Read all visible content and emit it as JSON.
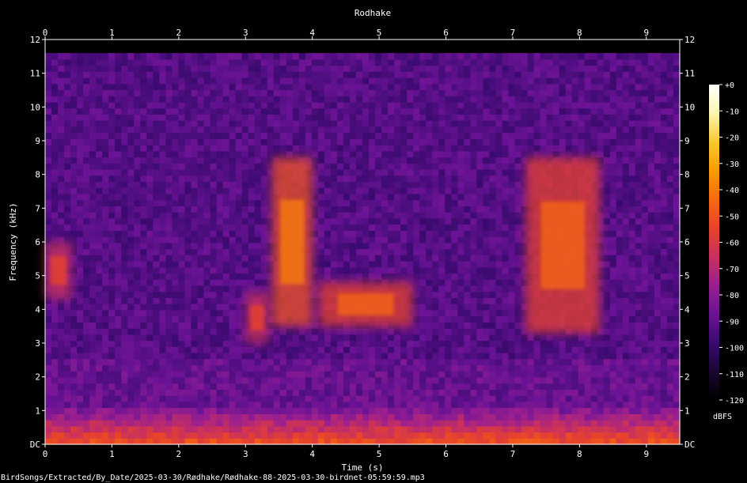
{
  "chart_data": {
    "type": "heatmap",
    "title": "Rodhake",
    "xlabel": "Time (s)",
    "ylabel": "Frequency (kHz)",
    "xlim": [
      0,
      9.5
    ],
    "ylim": [
      0,
      12
    ],
    "x_ticks": [
      "0",
      "1",
      "2",
      "3",
      "4",
      "5",
      "6",
      "7",
      "8",
      "9"
    ],
    "y_ticks": [
      "DC",
      "1",
      "2",
      "3",
      "4",
      "5",
      "6",
      "7",
      "8",
      "9",
      "10",
      "11",
      "12"
    ],
    "colorbar": {
      "label": "dBFS",
      "ticks": [
        "+0",
        "-10",
        "-20",
        "-30",
        "-40",
        "-50",
        "-60",
        "-70",
        "-80",
        "-90",
        "-100",
        "-110",
        "-120"
      ],
      "range": [
        -120,
        0
      ],
      "colors": [
        "#000000",
        "#1a0733",
        "#3a0a6e",
        "#6a1395",
        "#9a1f8f",
        "#c8305e",
        "#e8432b",
        "#f76a10",
        "#fb9b06",
        "#f8c82e",
        "#fcf6b0",
        "#ffffff"
      ]
    },
    "vocal_events": [
      {
        "t_start": 0.0,
        "t_end": 0.4,
        "f_low": 4.3,
        "f_high": 6.0,
        "peak_dbfs": -55
      },
      {
        "t_start": 3.0,
        "t_end": 3.35,
        "f_low": 3.0,
        "f_high": 4.5,
        "peak_dbfs": -55
      },
      {
        "t_start": 3.4,
        "t_end": 4.0,
        "f_low": 3.5,
        "f_high": 8.5,
        "peak_dbfs": -40
      },
      {
        "t_start": 4.1,
        "t_end": 5.5,
        "f_low": 3.5,
        "f_high": 4.8,
        "peak_dbfs": -45
      },
      {
        "t_start": 7.2,
        "t_end": 8.3,
        "f_low": 3.3,
        "f_high": 8.5,
        "peak_dbfs": -45
      }
    ]
  },
  "footer": {
    "path": "BirdSongs/Extracted/By_Date/2025-03-30/Rødhake/Rødhake-88-2025-03-30-birdnet-05:59:59.mp3"
  }
}
